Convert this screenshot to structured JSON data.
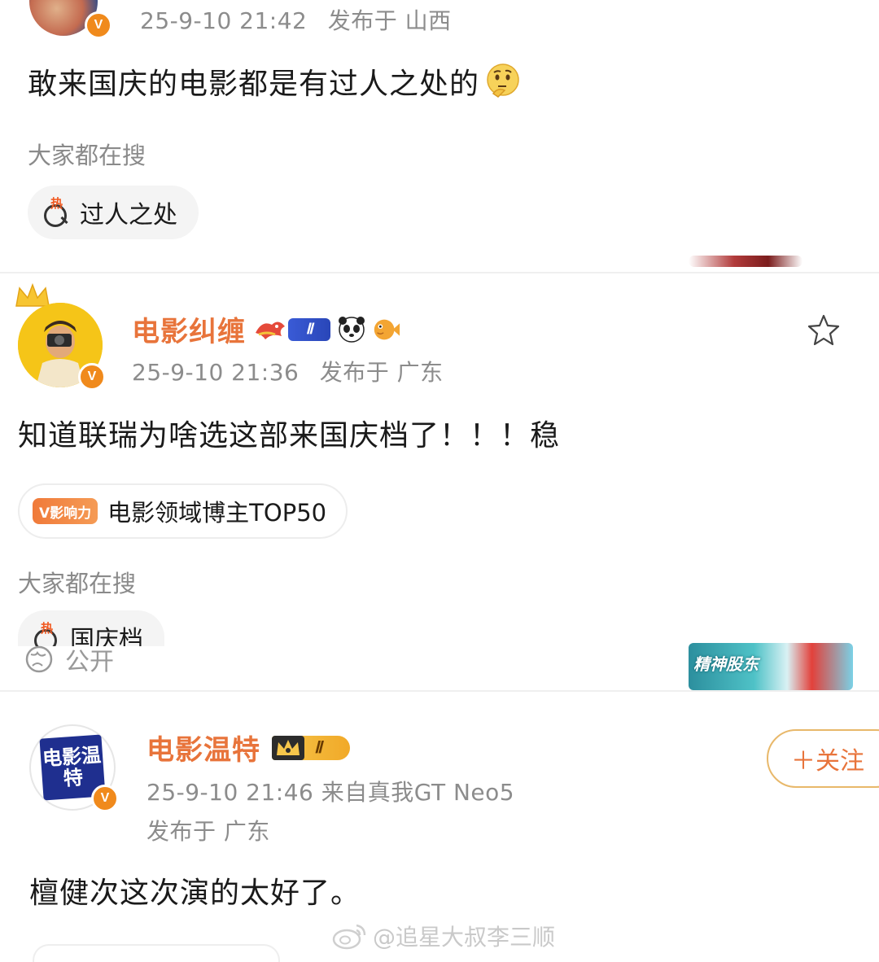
{
  "post1": {
    "timestamp": "25-9-10 21:42",
    "location": "发布于 山西",
    "text": "敢来国庆的电影都是有过人之处的",
    "text_emoji": "thinking-face",
    "search_label": "大家都在搜",
    "hot_search": "过人之处"
  },
  "post2": {
    "username": "电影纠缠",
    "level": "Ⅱ",
    "timestamp": "25-9-10 21:36",
    "location": "发布于 广东",
    "text": "知道联瑞为啥选这部来国庆档了！！！稳",
    "influence_tag": "V影响力",
    "influence_text": "电影领域博主TOP50",
    "search_label": "大家都在搜",
    "hot_search": "国庆档",
    "visibility": "公开",
    "promo_text": "精神股东"
  },
  "post3": {
    "username": "电影温特",
    "level": "Ⅱ",
    "avatar_text": "电影温特",
    "timestamp_device": "25-9-10 21:46  来自真我GT Neo5",
    "location": "发布于 广东",
    "follow_label": "＋关注",
    "text": "檀健次这次演的太好了。"
  },
  "watermark": "@追星大叔李三顺",
  "colors": {
    "username": "#e8743b",
    "verified": "#f08a1c",
    "hot": "#f15a22",
    "meta": "#8c8c8c"
  }
}
